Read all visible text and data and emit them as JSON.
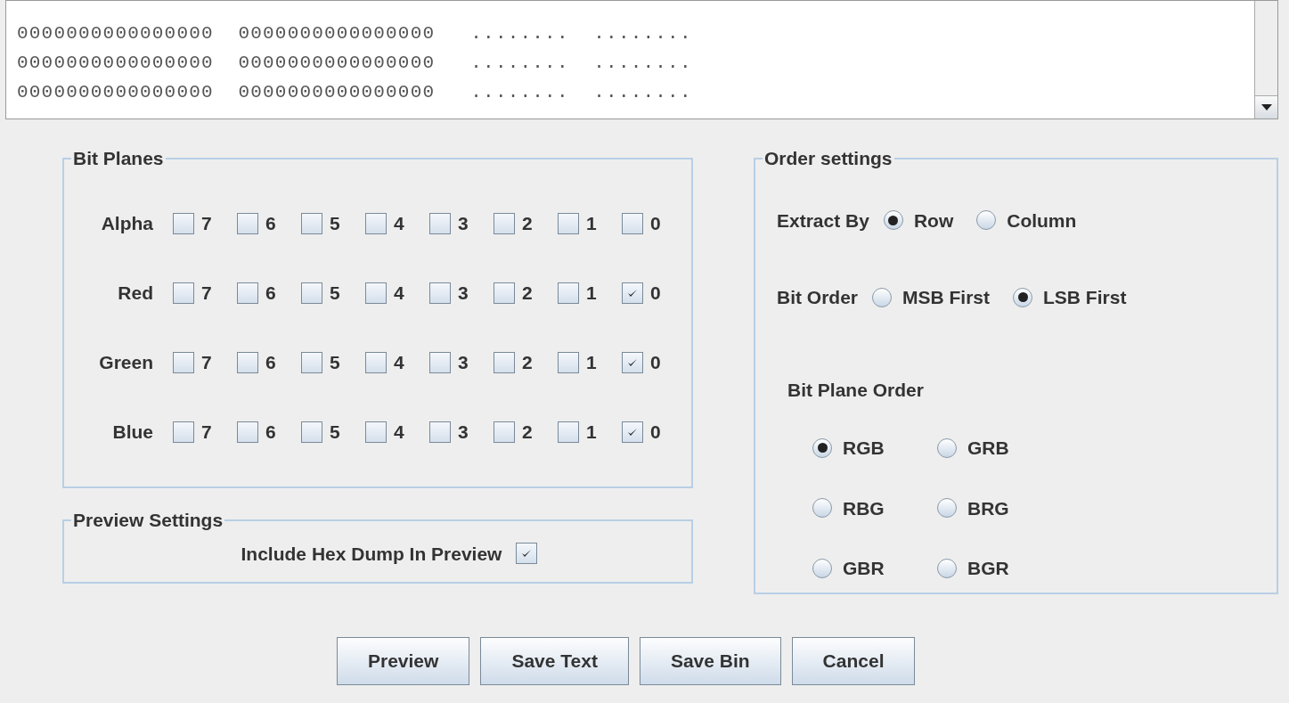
{
  "hex_dump": {
    "lines": [
      {
        "hex": "0000000000000000  0000000000000000",
        "ascii": "........  ........"
      },
      {
        "hex": "0000000000000000  0000000000000000",
        "ascii": "........  ........"
      },
      {
        "hex": "0000000000000000  0000000000000000",
        "ascii": "........  ........"
      }
    ]
  },
  "bit_planes": {
    "title": "Bit Planes",
    "channels": [
      {
        "name": "Alpha",
        "bits": [
          {
            "label": "7",
            "checked": false
          },
          {
            "label": "6",
            "checked": false
          },
          {
            "label": "5",
            "checked": false
          },
          {
            "label": "4",
            "checked": false
          },
          {
            "label": "3",
            "checked": false
          },
          {
            "label": "2",
            "checked": false
          },
          {
            "label": "1",
            "checked": false
          },
          {
            "label": "0",
            "checked": false
          }
        ]
      },
      {
        "name": "Red",
        "bits": [
          {
            "label": "7",
            "checked": false
          },
          {
            "label": "6",
            "checked": false
          },
          {
            "label": "5",
            "checked": false
          },
          {
            "label": "4",
            "checked": false
          },
          {
            "label": "3",
            "checked": false
          },
          {
            "label": "2",
            "checked": false
          },
          {
            "label": "1",
            "checked": false
          },
          {
            "label": "0",
            "checked": true
          }
        ]
      },
      {
        "name": "Green",
        "bits": [
          {
            "label": "7",
            "checked": false
          },
          {
            "label": "6",
            "checked": false
          },
          {
            "label": "5",
            "checked": false
          },
          {
            "label": "4",
            "checked": false
          },
          {
            "label": "3",
            "checked": false
          },
          {
            "label": "2",
            "checked": false
          },
          {
            "label": "1",
            "checked": false
          },
          {
            "label": "0",
            "checked": true
          }
        ]
      },
      {
        "name": "Blue",
        "bits": [
          {
            "label": "7",
            "checked": false
          },
          {
            "label": "6",
            "checked": false
          },
          {
            "label": "5",
            "checked": false
          },
          {
            "label": "4",
            "checked": false
          },
          {
            "label": "3",
            "checked": false
          },
          {
            "label": "2",
            "checked": false
          },
          {
            "label": "1",
            "checked": false
          },
          {
            "label": "0",
            "checked": true
          }
        ]
      }
    ]
  },
  "preview_settings": {
    "title": "Preview Settings",
    "include_hex_dump": {
      "label": "Include Hex Dump In Preview",
      "checked": true
    }
  },
  "order_settings": {
    "title": "Order settings",
    "extract_by": {
      "label": "Extract By",
      "options": [
        {
          "label": "Row",
          "selected": true
        },
        {
          "label": "Column",
          "selected": false
        }
      ]
    },
    "bit_order": {
      "label": "Bit Order",
      "options": [
        {
          "label": "MSB First",
          "selected": false
        },
        {
          "label": "LSB First",
          "selected": true
        }
      ]
    },
    "bit_plane_order": {
      "label": "Bit Plane Order",
      "options": [
        {
          "label": "RGB",
          "selected": true
        },
        {
          "label": "GRB",
          "selected": false
        },
        {
          "label": "RBG",
          "selected": false
        },
        {
          "label": "BRG",
          "selected": false
        },
        {
          "label": "GBR",
          "selected": false
        },
        {
          "label": "BGR",
          "selected": false
        }
      ]
    }
  },
  "buttons": [
    "Preview",
    "Save Text",
    "Save Bin",
    "Cancel"
  ]
}
